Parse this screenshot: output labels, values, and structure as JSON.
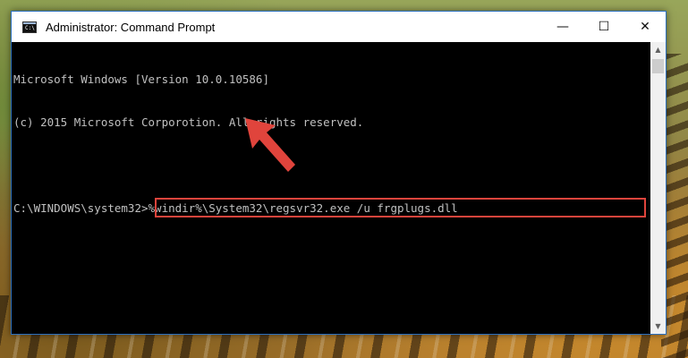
{
  "window": {
    "title": "Administrator: Command Prompt",
    "controls": {
      "minimize": "—",
      "maximize": "☐",
      "close": "✕"
    }
  },
  "console": {
    "lines": [
      "Microsoft Windows [Version 10.0.10586]",
      "(c) 2015 Microsoft Corporotion. All rights reserved."
    ],
    "prompt": "C:\\WINDOWS\\system32>",
    "command": "%windir%\\System32\\regsvr32.exe /u frgplugs.dll"
  },
  "scrollbar": {
    "up": "▲",
    "down": "▼"
  },
  "colors": {
    "highlight": "#e0443c",
    "arrow": "#e0443c",
    "console_bg": "#000000",
    "console_text": "#c0c0c0"
  },
  "icons": {
    "app_icon": "cmd-icon",
    "annotation": "red-arrow-icon"
  }
}
